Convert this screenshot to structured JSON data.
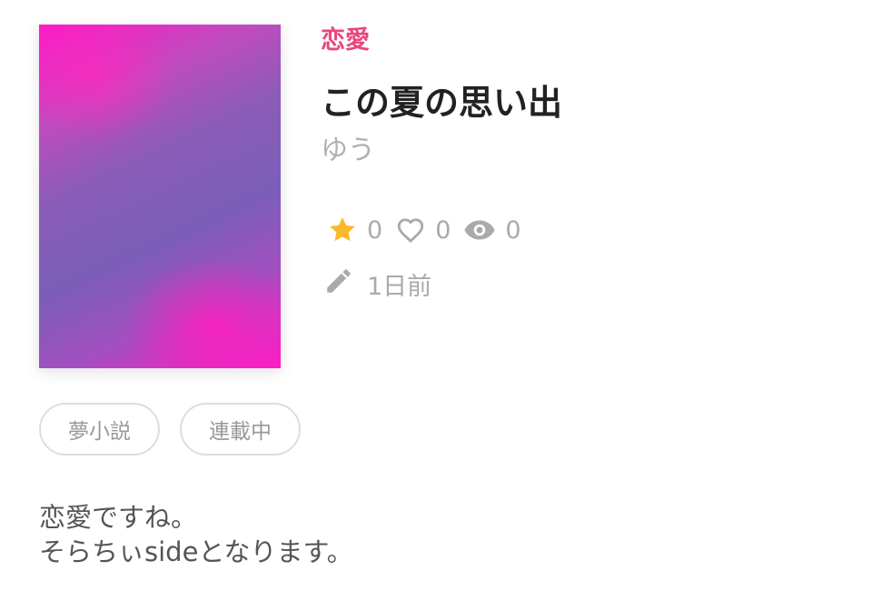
{
  "cover": {
    "colors": [
      "#ff17c8",
      "#8a5cb8",
      "#7b5eb9"
    ]
  },
  "genre": "恋愛",
  "title": "この夏の思い出",
  "author": "ゆう",
  "stats": {
    "stars": "0",
    "likes": "0",
    "views": "0"
  },
  "updated": "1日前",
  "tags": [
    "夢小説",
    "連載中"
  ],
  "description": {
    "line1": "恋愛ですね。",
    "line2": "そらちぃsideとなります。"
  },
  "colors": {
    "genre": "#e9467c",
    "star": "#fbb829",
    "muted": "#aaaaaa"
  }
}
